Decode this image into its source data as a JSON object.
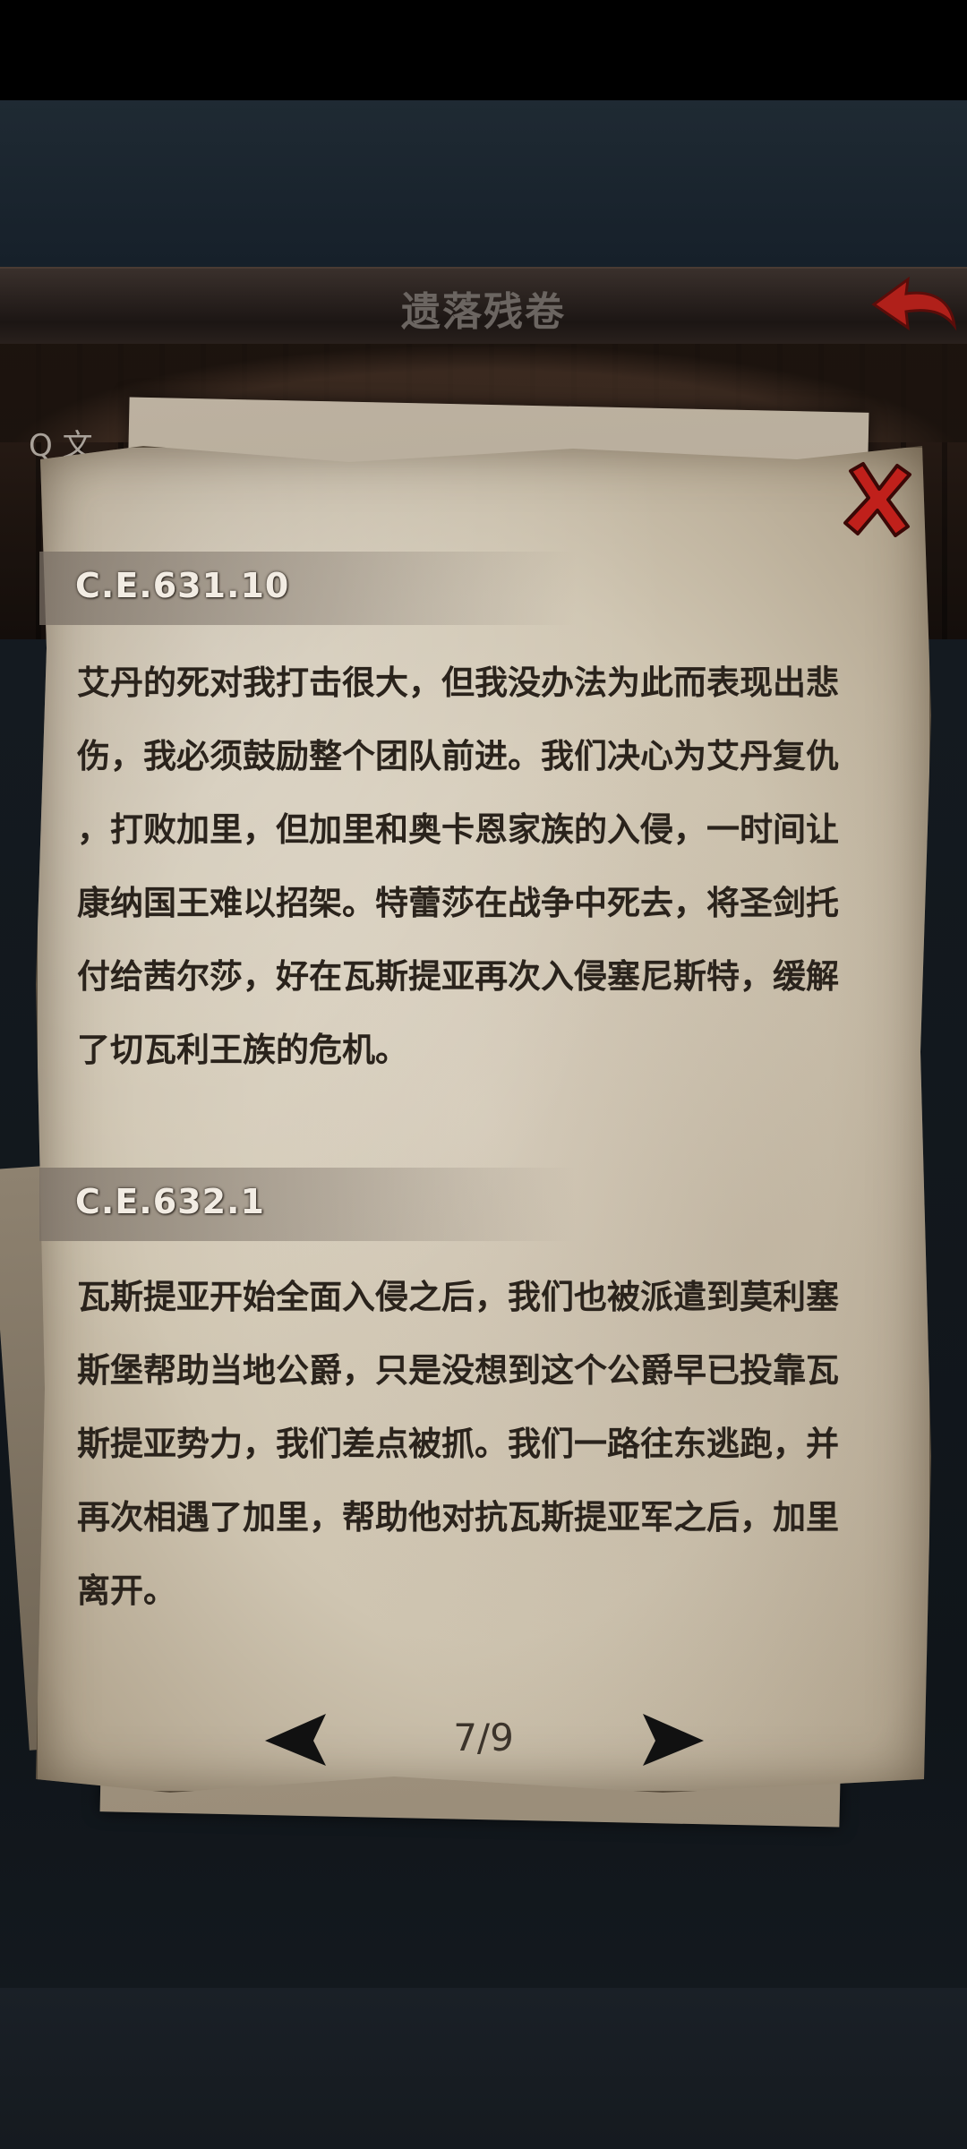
{
  "header": {
    "title": "遗落残卷",
    "back_icon": "back-arrow-icon"
  },
  "background": {
    "search_glyph": "Q 文"
  },
  "scroll": {
    "close_icon": "close-x-icon",
    "entries": [
      {
        "date": "C.E.631.10",
        "lines": [
          "艾丹的死对我打击很大，但我没办法为此而表现出悲",
          "伤，我必须鼓励整个团队前进。我们决心为艾丹复仇",
          "，打败加里，但加里和奥卡恩家族的入侵，一时间让",
          "康纳国王难以招架。特蕾莎在战争中死去，将圣剑托",
          "付给茜尔莎，好在瓦斯提亚再次入侵塞尼斯特，缓解",
          "了切瓦利王族的危机。"
        ]
      },
      {
        "date": "C.E.632.1",
        "lines": [
          "瓦斯提亚开始全面入侵之后，我们也被派遣到莫利塞",
          "斯堡帮助当地公爵，只是没想到这个公爵早已投靠瓦",
          "斯提亚势力，我们差点被抓。我们一路往东逃跑，并",
          "再次相遇了加里，帮助他对抗瓦斯提亚军之后，加里",
          "离开。"
        ]
      }
    ],
    "pagination": {
      "page": "7/9",
      "prev_icon": "prev-page-arrow-icon",
      "next_icon": "next-page-arrow-icon"
    }
  },
  "colors": {
    "title_text": "#6b6561",
    "back_arrow": "#b0201a",
    "close_x": "#c0201b",
    "ink": "#2a231c"
  }
}
